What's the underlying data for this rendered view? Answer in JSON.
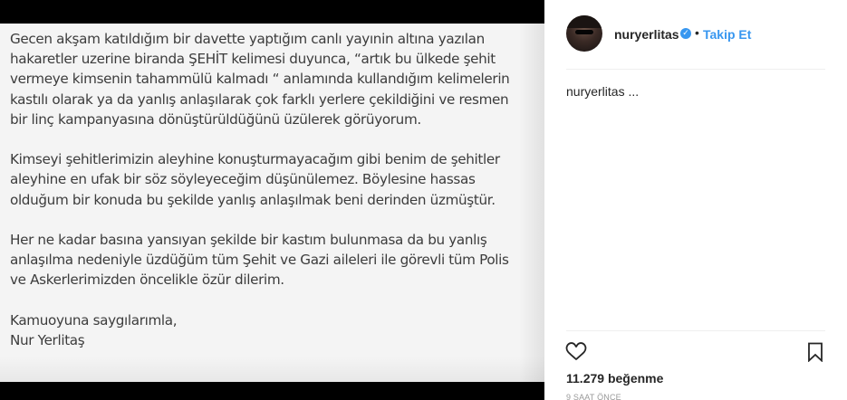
{
  "post": {
    "statement": {
      "paragraphs": [
        {
          "lines": [
            "Gecen akşam katıldığım bir davette yaptığım canlı yayınin altına yazılan",
            "hakaretler uzerine biranda ŞEHİT kelimesi duyunca, “artık bu ülkede şehit",
            "vermeye kimsenin tahammülü kalmadı “ anlamında kullandığım kelimelerin",
            "kastılı olarak ya da yanlış anlaşılarak çok farklı yerlere çekildiğini ve resmen",
            "bir linç kampanyasına dönüştürüldüğünü üzülerek görüyorum."
          ]
        },
        {
          "lines": [
            "Kimseyi şehitlerimizin aleyhine konuşturmayacağım gibi benim de şehitler",
            "aleyhine en ufak bir söz söyleyeceğim düşünülemez. Böylesine hassas",
            "olduğum bir konuda  bu şekilde yanlış anlaşılmak beni derinden üzmüştür."
          ]
        },
        {
          "lines": [
            "Her ne kadar basına yansıyan şekilde bir kastım bulunmasa da bu yanlış",
            "anlaşılma nedeniyle üzdüğüm tüm Şehit ve Gazi aileleri ile görevli tüm Polis",
            "ve Askerlerimizden öncelikle özür dilerim."
          ]
        },
        {
          "lines": [
            "Kamuoyuna saygılarımla,",
            "Nur Yerlitaş"
          ]
        }
      ]
    }
  },
  "header": {
    "username": "nuryerlitas",
    "verified_mark": "✓",
    "separator": "•",
    "follow_label": "Takip Et"
  },
  "caption": {
    "text": "nuryerlitas ..."
  },
  "actions": {
    "like_icon": "heart-icon",
    "save_icon": "bookmark-icon"
  },
  "stats": {
    "likes_count": "11.279",
    "likes_label": "beğenme",
    "time_ago": "9 SAAT ÖNCE"
  },
  "colors": {
    "accent": "#3897f0",
    "text": "#262626",
    "muted": "#999999"
  }
}
